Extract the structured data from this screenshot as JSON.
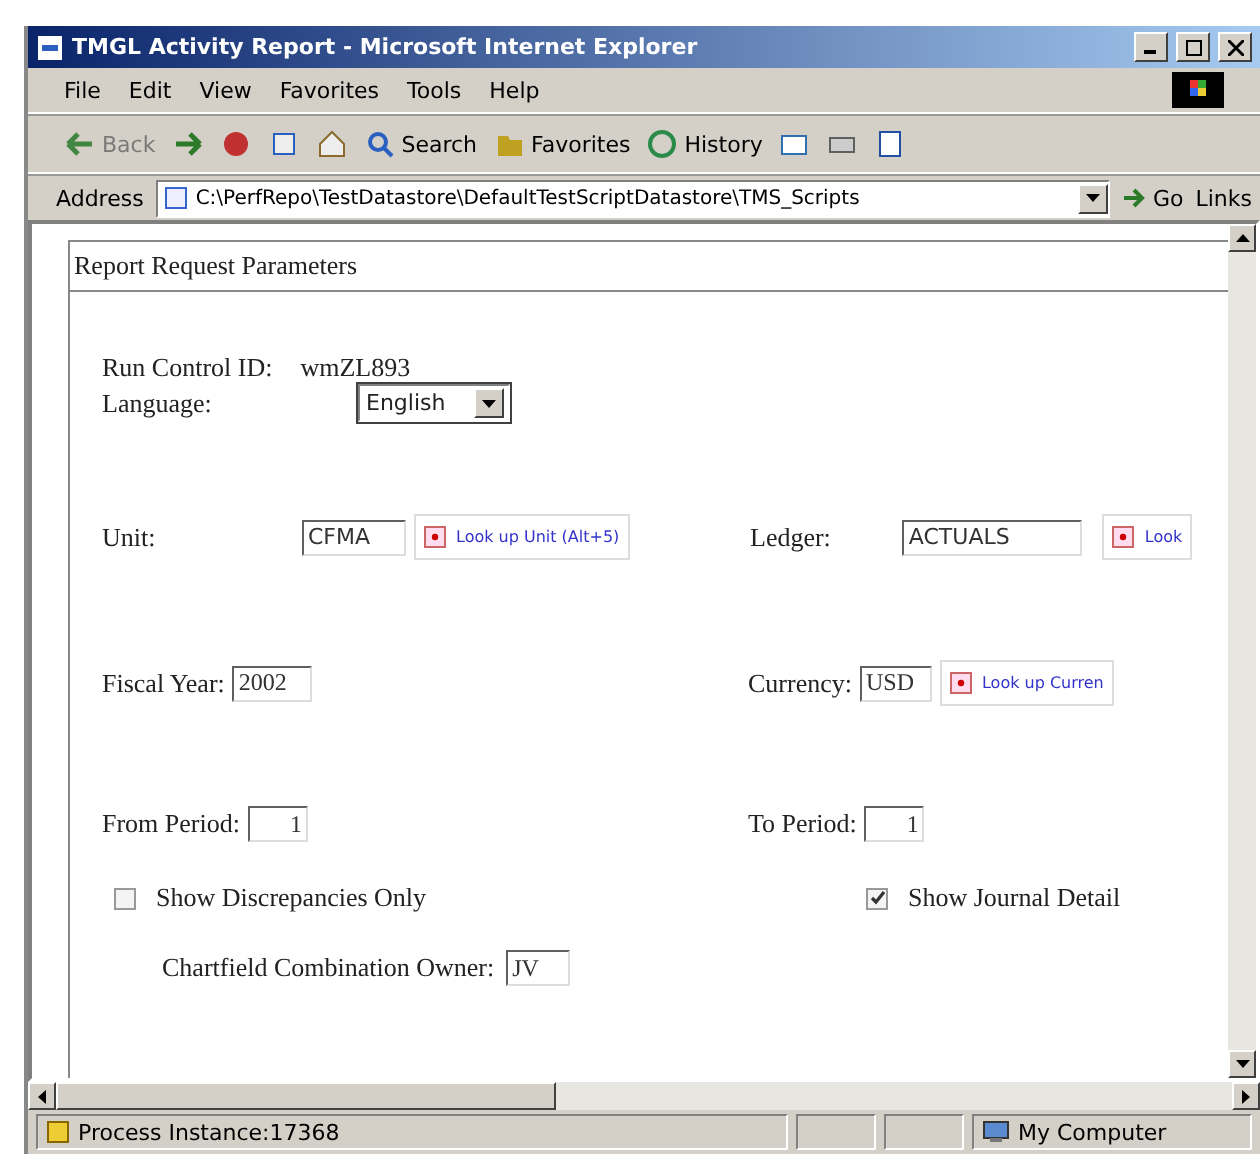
{
  "window": {
    "title": "TMGL Activity Report - Microsoft Internet Explorer"
  },
  "menu": [
    "File",
    "Edit",
    "View",
    "Favorites",
    "Tools",
    "Help"
  ],
  "toolbar": [
    {
      "kind": "back",
      "label": "Back",
      "disabled": true
    },
    {
      "kind": "forward",
      "disabled": false
    },
    {
      "kind": "stop",
      "disabled": false
    },
    {
      "kind": "refresh",
      "disabled": false
    },
    {
      "kind": "home",
      "disabled": false
    },
    {
      "kind": "search",
      "label": "Search",
      "disabled": false
    },
    {
      "kind": "favorites",
      "label": "Favorites",
      "disabled": false
    },
    {
      "kind": "history",
      "label": "History",
      "disabled": false
    },
    {
      "kind": "mail",
      "disabled": false
    },
    {
      "kind": "print",
      "disabled": false
    },
    {
      "kind": "edit",
      "disabled": false
    }
  ],
  "address": {
    "label": "Address",
    "value": "C:\\PerfRepo\\TestDatastore\\DefaultTestScriptDatastore\\TMS_Scripts",
    "go": "Go",
    "links": "Links"
  },
  "panel": {
    "title": "Report Request Parameters",
    "run_control": {
      "label": "Run Control ID:",
      "value": "wmZL893"
    },
    "language": {
      "label": "Language:",
      "value": "English"
    },
    "unit_row": [
      {
        "label": "Unit:",
        "value": "CFMA",
        "lookup": "Look up Unit (Alt+5)"
      },
      {
        "label": "Ledger:",
        "value": "ACTUALS",
        "lookup": "Look"
      }
    ],
    "fiscal_row": [
      {
        "label": "Fiscal Year:",
        "value": "2002"
      },
      {
        "label": "Currency:",
        "value": "USD",
        "lookup": "Look up Curren"
      }
    ],
    "period_row": [
      {
        "label": "From Period:",
        "value": "1"
      },
      {
        "label": "To Period:",
        "value": "1"
      }
    ],
    "checkboxes": [
      {
        "label": "Show Discrepancies Only",
        "checked": false
      },
      {
        "label": "Show Journal Detail",
        "checked": true
      }
    ],
    "owner": {
      "label": "Chartfield Combination Owner:",
      "value": "JV"
    }
  },
  "status_bar": {
    "text": "Process Instance:17368",
    "zone": "My Computer"
  }
}
